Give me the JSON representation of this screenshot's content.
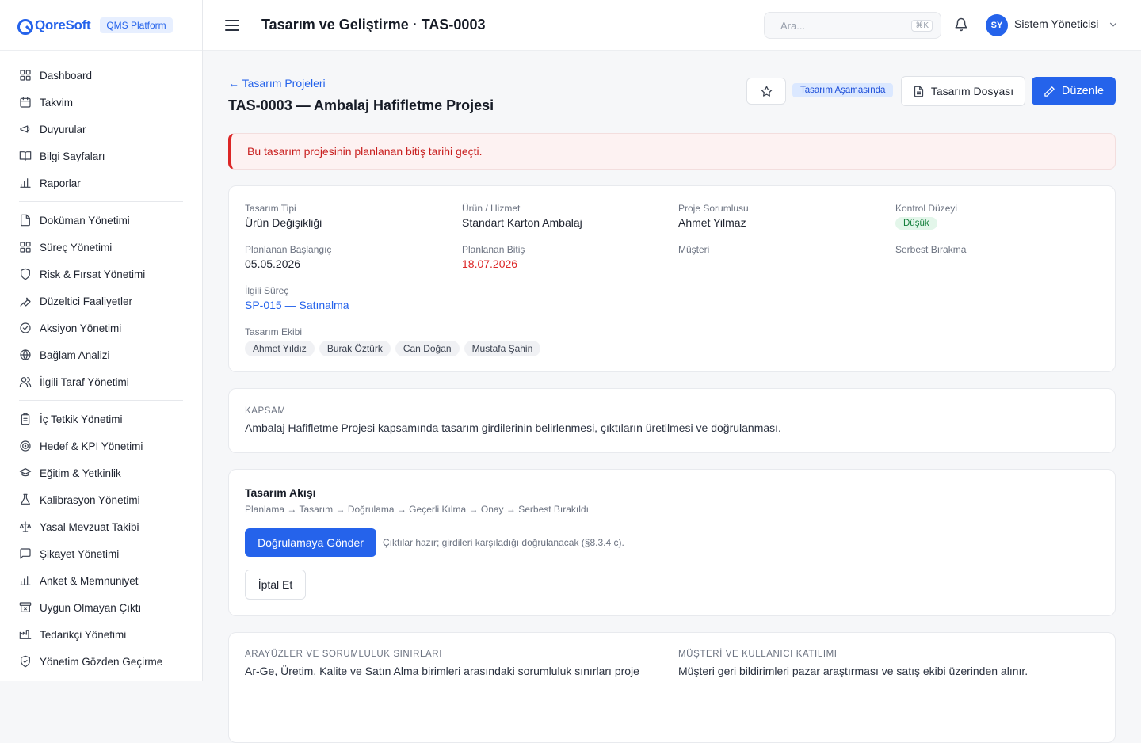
{
  "brand": {
    "name": "QoreSoft",
    "badge": "QMS Platform"
  },
  "sidebar": {
    "groups": [
      [
        {
          "label": "Dashboard",
          "icon": "grid-icon"
        },
        {
          "label": "Takvim",
          "icon": "calendar-icon"
        },
        {
          "label": "Duyurular",
          "icon": "megaphone-icon"
        },
        {
          "label": "Bilgi Sayfaları",
          "icon": "book-icon"
        },
        {
          "label": "Raporlar",
          "icon": "bar-chart-icon"
        }
      ],
      [
        {
          "label": "Doküman Yönetimi",
          "icon": "document-icon"
        },
        {
          "label": "Süreç Yönetimi",
          "icon": "grid-icon"
        },
        {
          "label": "Risk & Fırsat Yönetimi",
          "icon": "shield-icon"
        },
        {
          "label": "Düzeltici Faaliyetler",
          "icon": "wrench-icon"
        },
        {
          "label": "Aksiyon Yönetimi",
          "icon": "check-circle-icon"
        },
        {
          "label": "Bağlam Analizi",
          "icon": "globe-icon"
        },
        {
          "label": "İlgili Taraf Yönetimi",
          "icon": "users-icon"
        }
      ],
      [
        {
          "label": "İç Tetkik Yönetimi",
          "icon": "clipboard-icon"
        },
        {
          "label": "Hedef & KPI Yönetimi",
          "icon": "target-icon"
        },
        {
          "label": "Eğitim & Yetkinlik",
          "icon": "graduation-cap-icon"
        },
        {
          "label": "Kalibrasyon Yönetimi",
          "icon": "flask-icon"
        },
        {
          "label": "Yasal Mevzuat Takibi",
          "icon": "scale-icon"
        },
        {
          "label": "Şikayet Yönetimi",
          "icon": "message-icon"
        },
        {
          "label": "Anket & Memnuniyet",
          "icon": "bar-chart-icon"
        },
        {
          "label": "Uygun Olmayan Çıktı",
          "icon": "archive-x-icon"
        },
        {
          "label": "Tedarikçi Yönetimi",
          "icon": "factory-icon"
        },
        {
          "label": "Yönetim Gözden Geçirme",
          "icon": "shield-check-icon"
        }
      ]
    ]
  },
  "topbar": {
    "title": "Tasarım ve Geliştirme · TAS-0003",
    "search_placeholder": "Ara...",
    "search_shortcut": "⌘K",
    "user_initials": "SY",
    "user_name": "Sistem Yöneticisi"
  },
  "header": {
    "back_label": "← Tasarım Projeleri",
    "title": "TAS-0003 — Ambalaj Hafifletme Projesi",
    "status": "Tasarım Aşamasında",
    "file_button": "Tasarım Dosyası",
    "edit_button": "Düzenle"
  },
  "alert": {
    "text": "Bu tasarım projesinin planlanan bitiş tarihi geçti."
  },
  "info": {
    "design_type": {
      "label": "Tasarım Tipi",
      "value": "Ürün Değişikliği"
    },
    "product": {
      "label": "Ürün / Hizmet",
      "value": "Standart Karton Ambalaj"
    },
    "owner": {
      "label": "Proje Sorumlusu",
      "value": "Ahmet Yilmaz"
    },
    "control_level": {
      "label": "Kontrol Düzeyi",
      "value": "Düşük"
    },
    "planned_start": {
      "label": "Planlanan Başlangıç",
      "value": "05.05.2026"
    },
    "planned_end": {
      "label": "Planlanan Bitiş",
      "value": "18.07.2026"
    },
    "customer": {
      "label": "Müşteri",
      "value": "—"
    },
    "release": {
      "label": "Serbest Bırakma",
      "value": "—"
    },
    "process": {
      "label": "İlgili Süreç",
      "value": "SP-015 — Satınalma"
    },
    "team": {
      "label": "Tasarım Ekibi",
      "members": [
        "Ahmet Yıldız",
        "Burak Öztürk",
        "Can Doğan",
        "Mustafa Şahin"
      ]
    }
  },
  "scope": {
    "caption": "KAPSAM",
    "text": "Ambalaj Hafifletme Projesi kapsamında tasarım girdilerinin belirlenmesi, çıktıların üretilmesi ve doğrulanması."
  },
  "flow": {
    "title": "Tasarım Akışı",
    "steps": "Planlama → Tasarım → Doğrulama → Geçerli Kılma → Onay → Serbest Bırakıldı",
    "send_button": "Doğrulamaya Gönder",
    "send_note": "Çıktılar hazır; girdileri karşıladığı doğrulanacak (§8.3.4 c).",
    "cancel_button": "İptal Et"
  },
  "bottom": {
    "interfaces": {
      "caption": "ARAYÜZLER VE SORUMLULUK SINIRLARI",
      "text": "Ar-Ge, Üretim, Kalite ve Satın Alma birimleri arasındaki sorumluluk sınırları proje"
    },
    "customer_involvement": {
      "caption": "MÜŞTERİ VE KULLANICI KATILIMI",
      "text": "Müşteri geri bildirimleri pazar araştırması ve satış ekibi üzerinden alınır."
    }
  }
}
